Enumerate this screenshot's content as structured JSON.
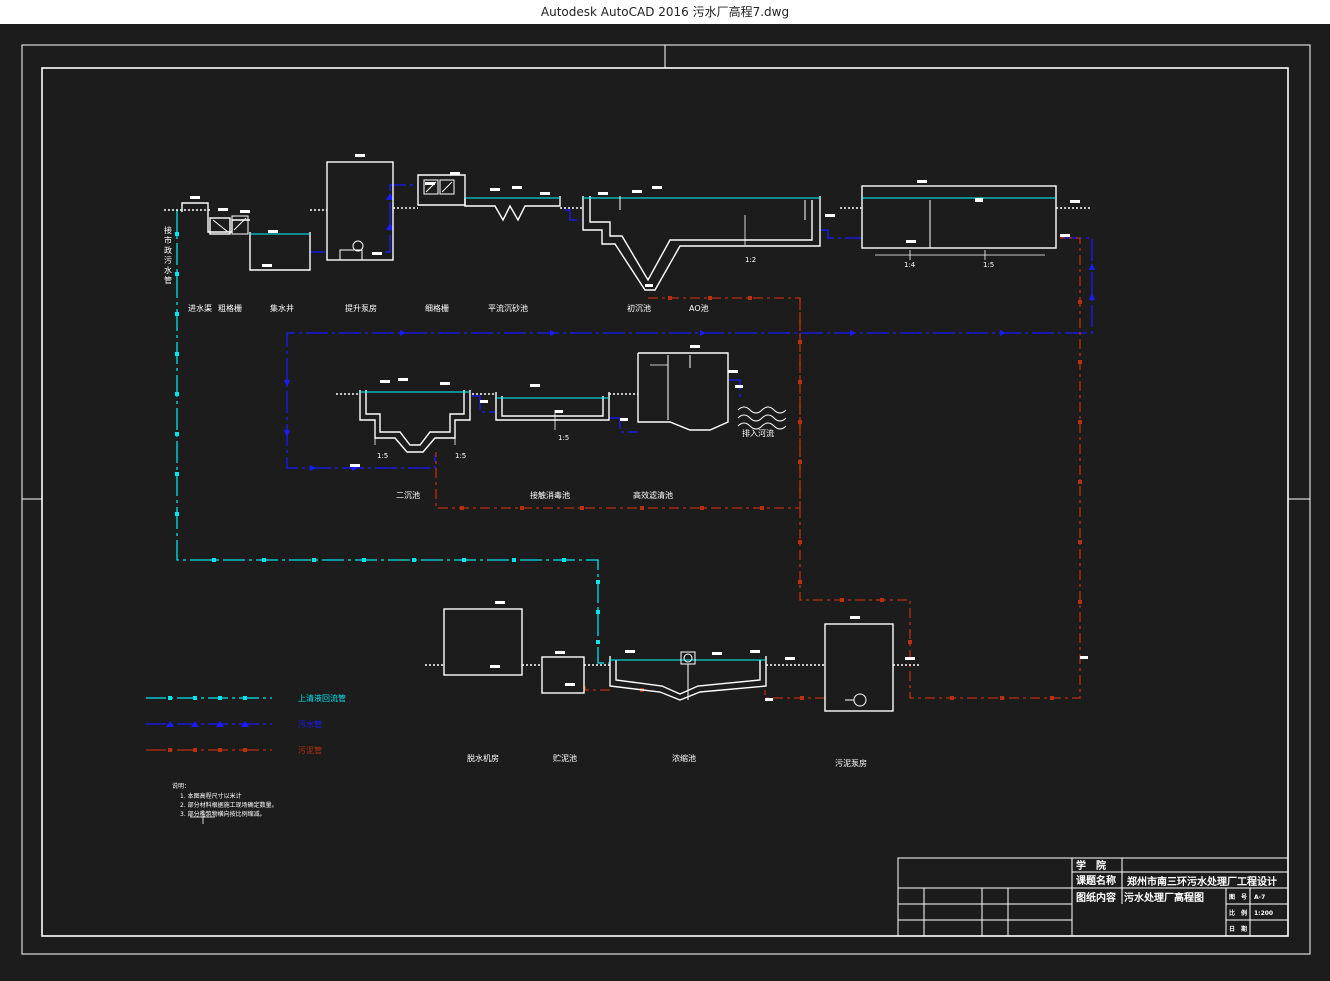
{
  "window": {
    "title": "Autodesk AutoCAD 2016    污水厂高程7.dwg"
  },
  "labels": {
    "inlet_vertical": "接市政污水管",
    "inlet": "进水渠",
    "coarse_screen": "粗格栅",
    "collect_well": "集水井",
    "lift_pump": "提升泵房",
    "fine_screen": "细格栅",
    "grit_chamber": "平流沉砂池",
    "primary_tank": "初沉池",
    "ao_tank": "AO池",
    "secondary_tank": "二沉池",
    "contact_tank": "接触消毒池",
    "filter": "高效滤清池",
    "outfall": "排入河流",
    "dewater": "脱水机房",
    "sludge_storage": "贮泥池",
    "thickener": "浓缩池",
    "sludge_pump": "污泥泵房",
    "slope_12": "1:2",
    "slope_14": "1:4",
    "slope_15": "1:5"
  },
  "legend": {
    "supernatant": "上清液回流管",
    "sewage": "污水管",
    "sludge": "污泥管"
  },
  "notes": {
    "title": "说明：",
    "items": [
      "1. 本图高程尺寸以米计",
      "2. 部分材料根据施工现场确定数量。",
      "3.        部分构筑物横向按比例缩减。"
    ]
  },
  "title_block": {
    "school_label": "学　院",
    "course_label": "课题名称",
    "course_value": "郑州市南三环污水处理厂工程设计",
    "content_label": "图纸内容",
    "content_value": "污水处理厂高程图",
    "sheet_label": "图　号",
    "sheet_value": "A-7",
    "scale_label": "比　例",
    "scale_value": "1:200",
    "date_label": "日　期"
  },
  "colors": {
    "background": "#1c1c1c",
    "structure": "#ffffff",
    "water_line": "#00ffff",
    "supernatant_pipe": "#00e5ee",
    "sewage_pipe": "#1a1aff",
    "sludge_pipe": "#b8300e",
    "yellow_text": "#ffff00"
  }
}
